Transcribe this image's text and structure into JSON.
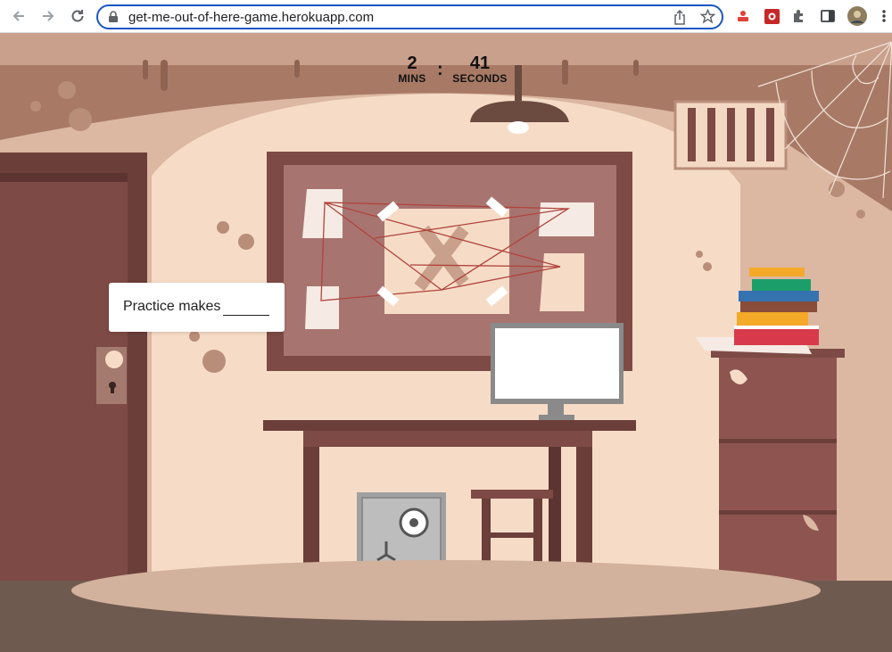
{
  "browser": {
    "url": "get-me-out-of-here-game.herokuapp.com",
    "nav": [
      "back-icon",
      "forward-icon",
      "reload-icon"
    ],
    "url_actions": [
      "share-icon",
      "bookmark-star-icon"
    ],
    "extensions": [
      "extension-red-icon",
      "extension-puzzle-piece-red-icon",
      "extensions-puzzle-icon",
      "sidepanel-icon",
      "profile-avatar",
      "more-menu-icon"
    ]
  },
  "game": {
    "timer": {
      "minutes": "2",
      "minutes_label": "MINS",
      "separator": ":",
      "seconds": "41",
      "seconds_label": "SECONDS"
    },
    "riddle": {
      "text": "Practice makes",
      "answer_value": ""
    },
    "colors": {
      "wall_light": "#f6dcc7",
      "wall_mid": "#dcb8a2",
      "wall_dark": "#a87a66",
      "wood_dark": "#6b3e3a",
      "wood_mid": "#7d4a45",
      "floor": "#6f5a50"
    }
  }
}
